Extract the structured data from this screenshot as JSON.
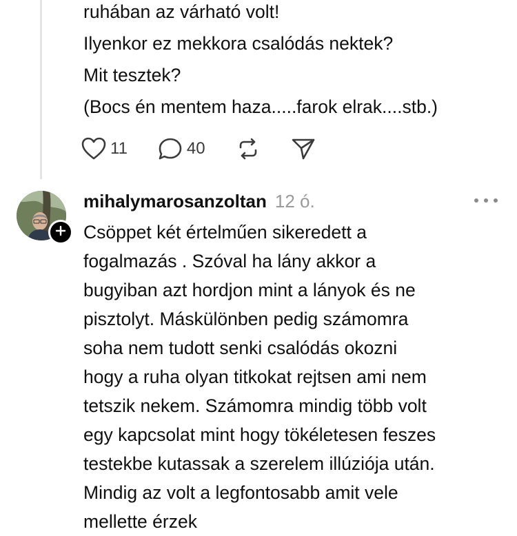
{
  "previous_comment": {
    "lines": [
      "ruhában az várható volt!",
      "Ilyenkor ez mekkora csalódás nektek?",
      "Mit tesztek?",
      "(Bocs én mentem haza.....farok elrak....stb.)"
    ],
    "actions": {
      "like_count": "11",
      "reply_count": "40"
    }
  },
  "comment": {
    "username": "mihalymarosanzoltan",
    "timestamp": "12 ó.",
    "lines": [
      "Csöppet két értelműen sikeredett a",
      "fogalmazás . Szóval ha lány akkor a",
      "bugyiban azt hordjon mint a lányok és ne",
      "pisztolyt. Máskülönben pedig számomra",
      "soha nem tudott senki csalódás okozni",
      "hogy a ruha olyan titkokat rejtsen ami nem",
      "tetszik nekem. Számomra mindig több volt",
      "egy kapcsolat mint hogy tökéletesen feszes",
      "testekbe kutassak a szerelem illúziója után.",
      "Mindig az volt a legfontosabb amit vele",
      "mellette érzek"
    ]
  },
  "icons": {
    "like": "heart-icon",
    "reply": "speech-bubble-icon",
    "repost": "repost-icon",
    "share": "send-icon",
    "more": "more-dots-icon",
    "follow": "plus-icon"
  },
  "colors": {
    "text": "#101010",
    "muted": "#9a9a9a",
    "thread_line": "#e4e4e4",
    "badge": "#000000"
  }
}
